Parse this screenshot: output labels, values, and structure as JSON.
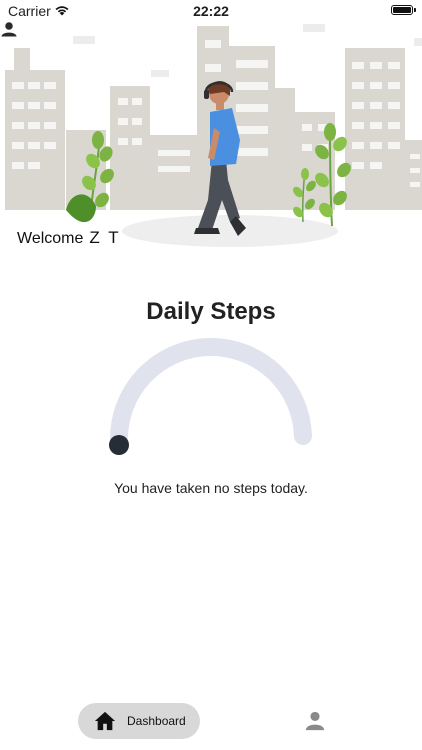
{
  "status_bar": {
    "carrier": "Carrier",
    "time": "22:22"
  },
  "header": {
    "welcome_label": "Welcome",
    "user_initials": "Z T"
  },
  "steps": {
    "title": "Daily Steps",
    "message": "You have taken no steps today.",
    "progress": 0
  },
  "nav": {
    "dashboard_label": "Dashboard"
  },
  "colors": {
    "gauge_track": "#e0e3ee",
    "gauge_knob": "#262d36",
    "nav_active_bg": "#d8d8d8"
  }
}
